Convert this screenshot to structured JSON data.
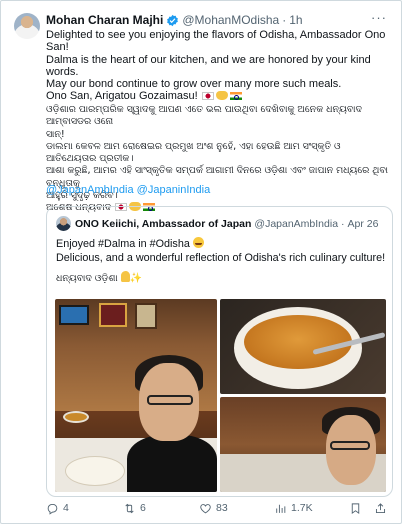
{
  "author": {
    "name": "Mohan Charan Majhi",
    "handle": "@MohanMOdisha",
    "separator": "·",
    "time": "1h",
    "more_label": "···"
  },
  "post": {
    "en_lines": [
      "Delighted to see you enjoying the flavors of Odisha, Ambassador Ono San!",
      "Dalma is the heart of our kitchen, and we are honored by your kind words.",
      "May our bond continue to grow over many more such meals."
    ],
    "en_sign": "Ono San, Arigatou Gozaimasu!",
    "or_lines": [
      "ଓଡ଼ିଶାର ପାରମ୍ପରିକ ସ୍ୱାଦକୁ ଆପଣ ଏତେ ଭଲ ପାଉଥିବା ଦେଖିବାକୁ ଅନେକ ଧନ୍ୟବାଦ ଆମ୍ବାସଡର ଓନୋ",
      "ସାନ୍!",
      "ଡାଲମା କେବଳ ଆମ ରୋଷେଇର ପ୍ରମୁଖ ଅଂଶ ନୁହେଁ, ଏହା ହେଉଛି ଆମ ସଂସ୍କୃତି ଓ ଆତିଥେୟତାର ପ୍ରତୀକ।",
      "ଆଶା କରୁଛି, ଆମର ଏହି ସାଂସ୍କୃତିକ ସମ୍ପର୍କ ଆଗାମୀ ଦିନରେ ଓଡ଼ିଶା ଏବଂ ଜାପାନ ମଧ୍ୟରେ ଥିବା ବନ୍ଧୁତାକୁ",
      "ଆହୁରି ସୁଦୃଢ଼ କରିବ।"
    ],
    "or_sign": "ଅଶେଷ ଧନ୍ୟବାଦ",
    "mentions": [
      "@JapanAmbIndia",
      "@JapaninIndia"
    ]
  },
  "quote": {
    "name": "ONO Keiichi, Ambassador of Japan",
    "handle": "@JapanAmbIndia",
    "separator": "·",
    "time": "Apr 26",
    "line1": "Enjoyed #Dalma in #Odisha",
    "line2": "Delicious, and a wonderful reflection of Odisha's rich culinary culture!",
    "line3": "ଧନ୍ୟବାଦ ଓଡ଼ିଶା"
  },
  "actions": {
    "replies": "4",
    "reposts": "6",
    "likes": "83",
    "views": "1.7K"
  },
  "colors": {
    "link": "#1d9bf0",
    "muted": "#536471",
    "verified": "#1d9bf0",
    "border": "#cfd9de"
  },
  "icons": {
    "verified": "verified-badge-icon",
    "reply": "reply-icon",
    "repost": "repost-icon",
    "like": "heart-icon",
    "views": "views-chart-icon",
    "bookmark": "bookmark-icon",
    "share": "share-icon"
  }
}
